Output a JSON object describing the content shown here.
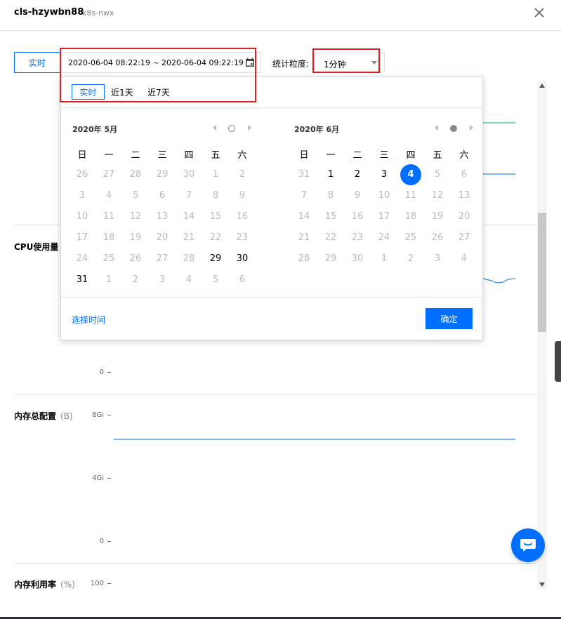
{
  "header": {
    "title": "cls-hzywbn88",
    "subtitle": "k8s-nwx",
    "close_icon": "close-icon"
  },
  "toolbar": {
    "realtime_label": "实时",
    "range_value": "2020-06-04 08:22:19 ~ 2020-06-04 09:22:19",
    "calendar_icon": "calendar-icon",
    "granularity_label": "统计粒度:",
    "granularity_value": "1分钟"
  },
  "popup": {
    "quick_options": [
      "实时",
      "近1天",
      "近7天"
    ],
    "left_month": {
      "title": "2020年 5月",
      "weekdays": [
        "日",
        "一",
        "二",
        "三",
        "四",
        "五",
        "六"
      ],
      "days": [
        [
          "26",
          "27",
          "28",
          "29",
          "30",
          "1",
          "2"
        ],
        [
          "3",
          "4",
          "5",
          "6",
          "7",
          "8",
          "9"
        ],
        [
          "10",
          "11",
          "12",
          "13",
          "14",
          "15",
          "16"
        ],
        [
          "17",
          "18",
          "19",
          "20",
          "21",
          "22",
          "23"
        ],
        [
          "24",
          "25",
          "26",
          "27",
          "28",
          "29",
          "30"
        ],
        [
          "31",
          "1",
          "2",
          "3",
          "4",
          "5",
          "6"
        ]
      ]
    },
    "right_month": {
      "title": "2020年 6月",
      "weekdays": [
        "日",
        "一",
        "二",
        "三",
        "四",
        "五",
        "六"
      ],
      "days": [
        [
          "31",
          "1",
          "2",
          "3",
          "4",
          "5",
          "6"
        ],
        [
          "7",
          "8",
          "9",
          "10",
          "11",
          "12",
          "13"
        ],
        [
          "14",
          "15",
          "16",
          "17",
          "18",
          "19",
          "20"
        ],
        [
          "21",
          "22",
          "23",
          "24",
          "25",
          "26",
          "27"
        ],
        [
          "28",
          "29",
          "30",
          "1",
          "2",
          "3",
          "4"
        ]
      ]
    },
    "select_time_label": "选择时间",
    "confirm_label": "确定"
  },
  "sections": [
    {
      "title": "CPU使用量",
      "unit": "",
      "ticks": [
        "0"
      ]
    },
    {
      "title": "内存总配置",
      "unit": "(B)",
      "ticks": [
        "8Gi",
        "4Gi",
        "0"
      ]
    },
    {
      "title": "内存利用率",
      "unit": "(%)",
      "ticks": [
        "100"
      ]
    }
  ],
  "colors": {
    "accent": "#006eff",
    "highlight": "#e02020",
    "series_green": "#2ec27e",
    "series_blue": "#2b8be8"
  },
  "chat_icon": "chat-icon"
}
